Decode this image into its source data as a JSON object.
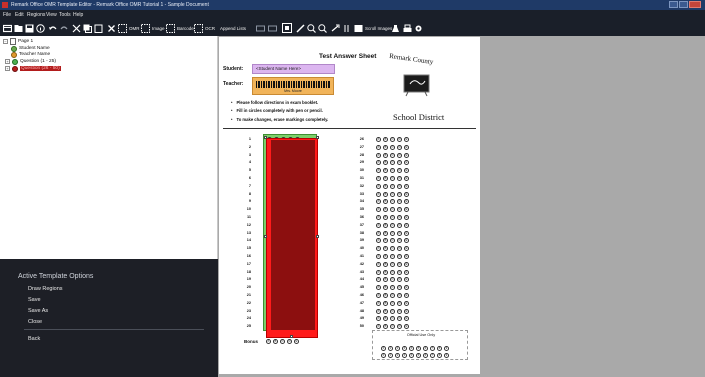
{
  "window": {
    "title": "Remark Office OMR Template Editor - Remark Office OMR Tutorial 1 - Sample Document"
  },
  "menu": [
    "File",
    "Edit",
    "Regions",
    "View",
    "Tools",
    "Help"
  ],
  "toolbar": {
    "omr_label": "OMR",
    "image_label": "Image",
    "barcode_label": "Barcode",
    "ocr_label": "OCR",
    "append_label": "Append Lists",
    "scroll_label": "Scroll Images"
  },
  "tree": {
    "page": "Page 1",
    "items": [
      {
        "label": "Student Name"
      },
      {
        "label": "Teacher Name"
      },
      {
        "label": "Question (1 - 25)"
      },
      {
        "label": "Question (26 - 50)"
      }
    ]
  },
  "options": {
    "heading": "Active Template Options",
    "items": [
      "Draw Regions",
      "Save",
      "Save As",
      "Close"
    ],
    "back": "Back"
  },
  "sheet": {
    "title": "Test Answer Sheet",
    "student_label": "Student:",
    "student_value": "<Student Name Here>",
    "teacher_label": "Teacher:",
    "teacher_value": "Mrs. Moore",
    "logo_top": "Remark County",
    "district": "School District",
    "instructions": [
      "Please follow directions in exam booklet.",
      "Fill in circles completely with pen or pencil.",
      "To make changes, erase markings completely."
    ],
    "bonus_label": "Bonus",
    "official_label": "Official Use Only",
    "bubble_letters": [
      "A",
      "B",
      "C",
      "D",
      "E"
    ],
    "official_digits": [
      "0",
      "1",
      "2",
      "3",
      "4",
      "5",
      "6",
      "7",
      "8",
      "9"
    ]
  },
  "colors": {
    "green_region": "#7ccf6a",
    "red_region": "#ff1a1a",
    "student_field": "#dcb6f0",
    "teacher_field": "#f1b45a"
  }
}
